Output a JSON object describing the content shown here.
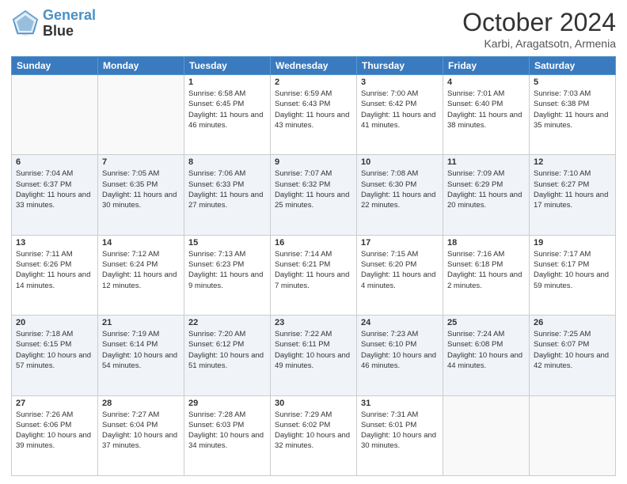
{
  "header": {
    "logo_line1": "General",
    "logo_line2": "Blue",
    "month": "October 2024",
    "location": "Karbi, Aragatsotn, Armenia"
  },
  "weekdays": [
    "Sunday",
    "Monday",
    "Tuesday",
    "Wednesday",
    "Thursday",
    "Friday",
    "Saturday"
  ],
  "weeks": [
    [
      {
        "day": "",
        "info": ""
      },
      {
        "day": "",
        "info": ""
      },
      {
        "day": "1",
        "info": "Sunrise: 6:58 AM\nSunset: 6:45 PM\nDaylight: 11 hours and 46 minutes."
      },
      {
        "day": "2",
        "info": "Sunrise: 6:59 AM\nSunset: 6:43 PM\nDaylight: 11 hours and 43 minutes."
      },
      {
        "day": "3",
        "info": "Sunrise: 7:00 AM\nSunset: 6:42 PM\nDaylight: 11 hours and 41 minutes."
      },
      {
        "day": "4",
        "info": "Sunrise: 7:01 AM\nSunset: 6:40 PM\nDaylight: 11 hours and 38 minutes."
      },
      {
        "day": "5",
        "info": "Sunrise: 7:03 AM\nSunset: 6:38 PM\nDaylight: 11 hours and 35 minutes."
      }
    ],
    [
      {
        "day": "6",
        "info": "Sunrise: 7:04 AM\nSunset: 6:37 PM\nDaylight: 11 hours and 33 minutes."
      },
      {
        "day": "7",
        "info": "Sunrise: 7:05 AM\nSunset: 6:35 PM\nDaylight: 11 hours and 30 minutes."
      },
      {
        "day": "8",
        "info": "Sunrise: 7:06 AM\nSunset: 6:33 PM\nDaylight: 11 hours and 27 minutes."
      },
      {
        "day": "9",
        "info": "Sunrise: 7:07 AM\nSunset: 6:32 PM\nDaylight: 11 hours and 25 minutes."
      },
      {
        "day": "10",
        "info": "Sunrise: 7:08 AM\nSunset: 6:30 PM\nDaylight: 11 hours and 22 minutes."
      },
      {
        "day": "11",
        "info": "Sunrise: 7:09 AM\nSunset: 6:29 PM\nDaylight: 11 hours and 20 minutes."
      },
      {
        "day": "12",
        "info": "Sunrise: 7:10 AM\nSunset: 6:27 PM\nDaylight: 11 hours and 17 minutes."
      }
    ],
    [
      {
        "day": "13",
        "info": "Sunrise: 7:11 AM\nSunset: 6:26 PM\nDaylight: 11 hours and 14 minutes."
      },
      {
        "day": "14",
        "info": "Sunrise: 7:12 AM\nSunset: 6:24 PM\nDaylight: 11 hours and 12 minutes."
      },
      {
        "day": "15",
        "info": "Sunrise: 7:13 AM\nSunset: 6:23 PM\nDaylight: 11 hours and 9 minutes."
      },
      {
        "day": "16",
        "info": "Sunrise: 7:14 AM\nSunset: 6:21 PM\nDaylight: 11 hours and 7 minutes."
      },
      {
        "day": "17",
        "info": "Sunrise: 7:15 AM\nSunset: 6:20 PM\nDaylight: 11 hours and 4 minutes."
      },
      {
        "day": "18",
        "info": "Sunrise: 7:16 AM\nSunset: 6:18 PM\nDaylight: 11 hours and 2 minutes."
      },
      {
        "day": "19",
        "info": "Sunrise: 7:17 AM\nSunset: 6:17 PM\nDaylight: 10 hours and 59 minutes."
      }
    ],
    [
      {
        "day": "20",
        "info": "Sunrise: 7:18 AM\nSunset: 6:15 PM\nDaylight: 10 hours and 57 minutes."
      },
      {
        "day": "21",
        "info": "Sunrise: 7:19 AM\nSunset: 6:14 PM\nDaylight: 10 hours and 54 minutes."
      },
      {
        "day": "22",
        "info": "Sunrise: 7:20 AM\nSunset: 6:12 PM\nDaylight: 10 hours and 51 minutes."
      },
      {
        "day": "23",
        "info": "Sunrise: 7:22 AM\nSunset: 6:11 PM\nDaylight: 10 hours and 49 minutes."
      },
      {
        "day": "24",
        "info": "Sunrise: 7:23 AM\nSunset: 6:10 PM\nDaylight: 10 hours and 46 minutes."
      },
      {
        "day": "25",
        "info": "Sunrise: 7:24 AM\nSunset: 6:08 PM\nDaylight: 10 hours and 44 minutes."
      },
      {
        "day": "26",
        "info": "Sunrise: 7:25 AM\nSunset: 6:07 PM\nDaylight: 10 hours and 42 minutes."
      }
    ],
    [
      {
        "day": "27",
        "info": "Sunrise: 7:26 AM\nSunset: 6:06 PM\nDaylight: 10 hours and 39 minutes."
      },
      {
        "day": "28",
        "info": "Sunrise: 7:27 AM\nSunset: 6:04 PM\nDaylight: 10 hours and 37 minutes."
      },
      {
        "day": "29",
        "info": "Sunrise: 7:28 AM\nSunset: 6:03 PM\nDaylight: 10 hours and 34 minutes."
      },
      {
        "day": "30",
        "info": "Sunrise: 7:29 AM\nSunset: 6:02 PM\nDaylight: 10 hours and 32 minutes."
      },
      {
        "day": "31",
        "info": "Sunrise: 7:31 AM\nSunset: 6:01 PM\nDaylight: 10 hours and 30 minutes."
      },
      {
        "day": "",
        "info": ""
      },
      {
        "day": "",
        "info": ""
      }
    ]
  ]
}
